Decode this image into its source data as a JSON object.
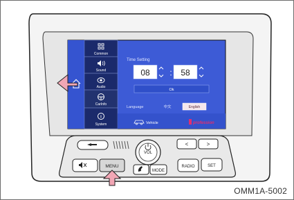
{
  "sidebar": {
    "items": [
      {
        "label": "Common",
        "icon": "grid-icon"
      },
      {
        "label": "Sound",
        "icon": "speaker-icon"
      },
      {
        "label": "Audio",
        "icon": "disc-icon"
      },
      {
        "label": "CarInfo",
        "icon": "steering-wheel-icon"
      },
      {
        "label": "System",
        "icon": "info-icon"
      }
    ]
  },
  "time_setting": {
    "title": "Time Setting",
    "hour": "08",
    "separator": ":",
    "minute": "58",
    "ok_label": "Ok"
  },
  "language": {
    "label": "Language",
    "option_chinese": "中文",
    "option_english": "English"
  },
  "bottom_bar": {
    "vehicle_label": "Vehicle",
    "brand_logo_text": "profession"
  },
  "controls": {
    "vol_label": "VOL",
    "menu_label": "MENU",
    "mode_label": "MODE",
    "radio_label": "RADIO",
    "set_label": "SET",
    "prev_label": "<",
    "next_label": ">"
  },
  "figure_code": "OMM1A-5002",
  "colors": {
    "screen_blue": "#3d5bd6",
    "sidebar_dark": "#1b2a6b",
    "sidebar_active": "#22326f",
    "ok_button": "#2f4fc9",
    "arrow_pink": "#f2a7b5"
  }
}
